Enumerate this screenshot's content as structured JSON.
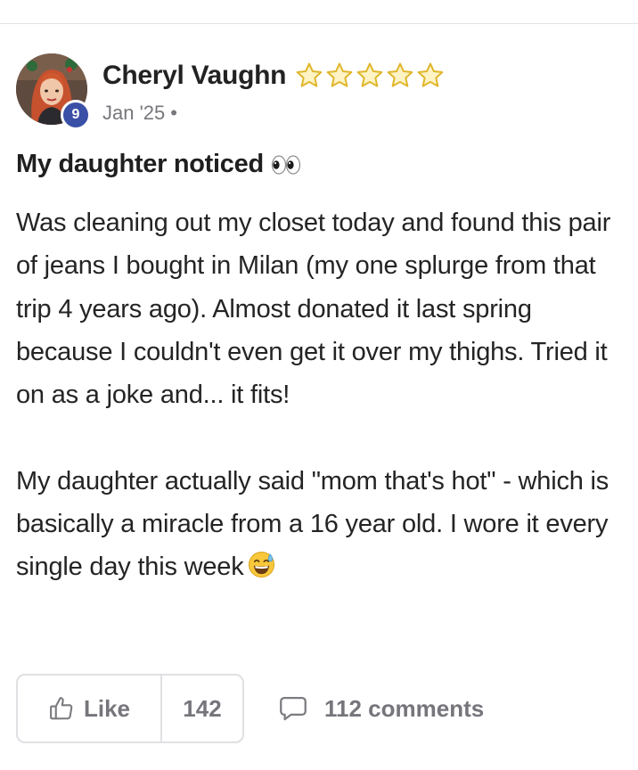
{
  "post": {
    "author": {
      "name": "Cheryl Vaughn",
      "level": "9",
      "rating_stars": 5
    },
    "meta": {
      "date": "Jan '25",
      "separator": "•"
    },
    "title": "My daughter noticed",
    "title_emoji": "eyes-emoji",
    "body": {
      "paragraph_1": "Was cleaning out my closet today and found this pair of jeans I bought in Milan (my one splurge from that trip 4 years ago). Almost donated it last spring because I couldn't even get it over my thighs. Tried it on as a joke and... it fits!",
      "paragraph_2": "My daughter actually said \"mom that's hot\" - which is basically a miracle from a 16 year old. I wore it every single day this week",
      "paragraph_2_emoji": "grinning-sweat-emoji"
    },
    "actions": {
      "like_label": "Like",
      "like_count": "142",
      "comments_label": "112 comments"
    }
  },
  "colors": {
    "badge": "#3a4fa6",
    "star_fill": "#fdf3c4",
    "star_stroke": "#e0b62b",
    "muted_text": "#75757b",
    "border": "#e0e0e4"
  }
}
